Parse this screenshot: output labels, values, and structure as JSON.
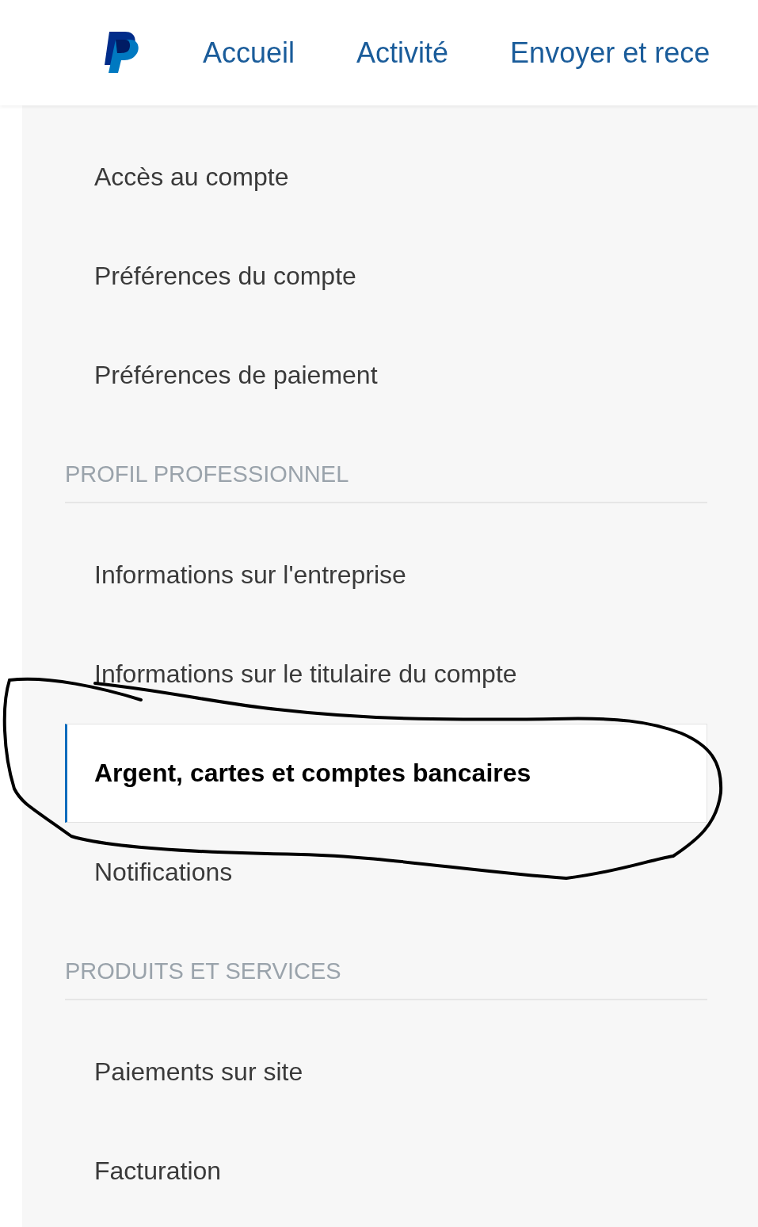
{
  "nav": {
    "links": [
      {
        "label": "Accueil"
      },
      {
        "label": "Activité"
      },
      {
        "label": "Envoyer et rece"
      }
    ]
  },
  "sidebar": {
    "entries": [
      {
        "kind": "item",
        "label": "Accès au compte",
        "selected": false
      },
      {
        "kind": "item",
        "label": "Préférences du compte",
        "selected": false
      },
      {
        "kind": "item",
        "label": "Préférences de paiement",
        "selected": false
      },
      {
        "kind": "header",
        "label": "PROFIL PROFESSIONNEL"
      },
      {
        "kind": "item",
        "label": "Informations sur l'entreprise",
        "selected": false
      },
      {
        "kind": "item",
        "label": "Informations sur le titulaire du compte",
        "selected": false
      },
      {
        "kind": "item",
        "label": "Argent, cartes et comptes bancaires",
        "selected": true
      },
      {
        "kind": "item",
        "label": "Notifications",
        "selected": false
      },
      {
        "kind": "header",
        "label": "PRODUITS ET SERVICES"
      },
      {
        "kind": "item",
        "label": "Paiements sur site",
        "selected": false
      },
      {
        "kind": "item",
        "label": "Facturation",
        "selected": false
      }
    ]
  },
  "annotation": {
    "kind": "circle"
  }
}
